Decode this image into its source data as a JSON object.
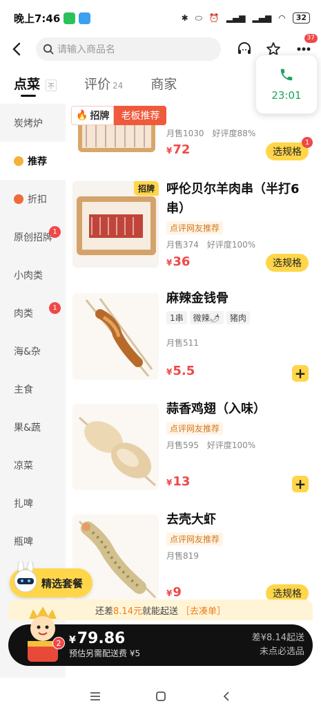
{
  "status": {
    "time": "晚上7:46",
    "battery": "32",
    "colors": {
      "wechat": "#2bc25e",
      "cloud": "#3aa0f0"
    }
  },
  "header": {
    "search_placeholder": "请输入商品名",
    "cart_badge": "37",
    "icons": [
      "back-arrow-icon",
      "search-icon",
      "customer-service-icon",
      "star-icon",
      "more-icon"
    ]
  },
  "call": {
    "time": "23:01"
  },
  "tabs": [
    {
      "label": "点菜",
      "sub": ""
    },
    {
      "label": "评价",
      "sub": "24"
    },
    {
      "label": "商家",
      "sub": ""
    }
  ],
  "sidebar": {
    "items": [
      {
        "label": "炭烤炉"
      },
      {
        "label": "推荐",
        "active": true
      },
      {
        "label": "折扣"
      },
      {
        "label": "原创招牌",
        "badge": "1"
      },
      {
        "label": "小肉类"
      },
      {
        "label": "肉类",
        "badge": "1"
      },
      {
        "label": "海&杂"
      },
      {
        "label": "主食"
      },
      {
        "label": "果&蔬"
      },
      {
        "label": "凉菜"
      },
      {
        "label": "扎啤"
      },
      {
        "label": "瓶啤"
      }
    ]
  },
  "section": {
    "tag_a": "招牌",
    "tag_b": "老板推荐"
  },
  "products": [
    {
      "title": "",
      "sales": "月售1030",
      "rating": "好评度88%",
      "price": "72",
      "action": "选规格",
      "action_badge": "1"
    },
    {
      "title": "呼伦贝尔羊肉串（半打6串）",
      "img_badge": "招牌",
      "tag": "点评网友推荐",
      "sales": "月售374",
      "rating": "好评度100%",
      "price": "36",
      "action": "选规格"
    },
    {
      "title": "麻辣金钱骨",
      "specs": [
        "1串",
        "微辣🌶",
        "猪肉"
      ],
      "sales": "月售511",
      "price": "5.5"
    },
    {
      "title": "蒜香鸡翅（入味）",
      "tag": "点评网友推荐",
      "sales": "月售595",
      "rating": "好评度100%",
      "price": "13"
    },
    {
      "title": "去壳大虾",
      "tag": "点评网友推荐",
      "sales": "月售819",
      "price": "9",
      "action": "选规格"
    }
  ],
  "set_meal": {
    "label": "精选套餐"
  },
  "promo": {
    "prefix": "还差",
    "amount": "8.14元",
    "suffix": "就能起送",
    "link": "［去凑单］"
  },
  "cart": {
    "count": "2",
    "currency": "¥",
    "total": "79.86",
    "fee": "预估另需配送费 ¥5",
    "diff": "差¥8.14起送",
    "required": "未点必选品"
  },
  "price_symbol": "¥",
  "accent_colors": {
    "yellow": "#ffd64a",
    "red": "#f04848",
    "orange": "#f07d1e",
    "green": "#1aa260"
  }
}
